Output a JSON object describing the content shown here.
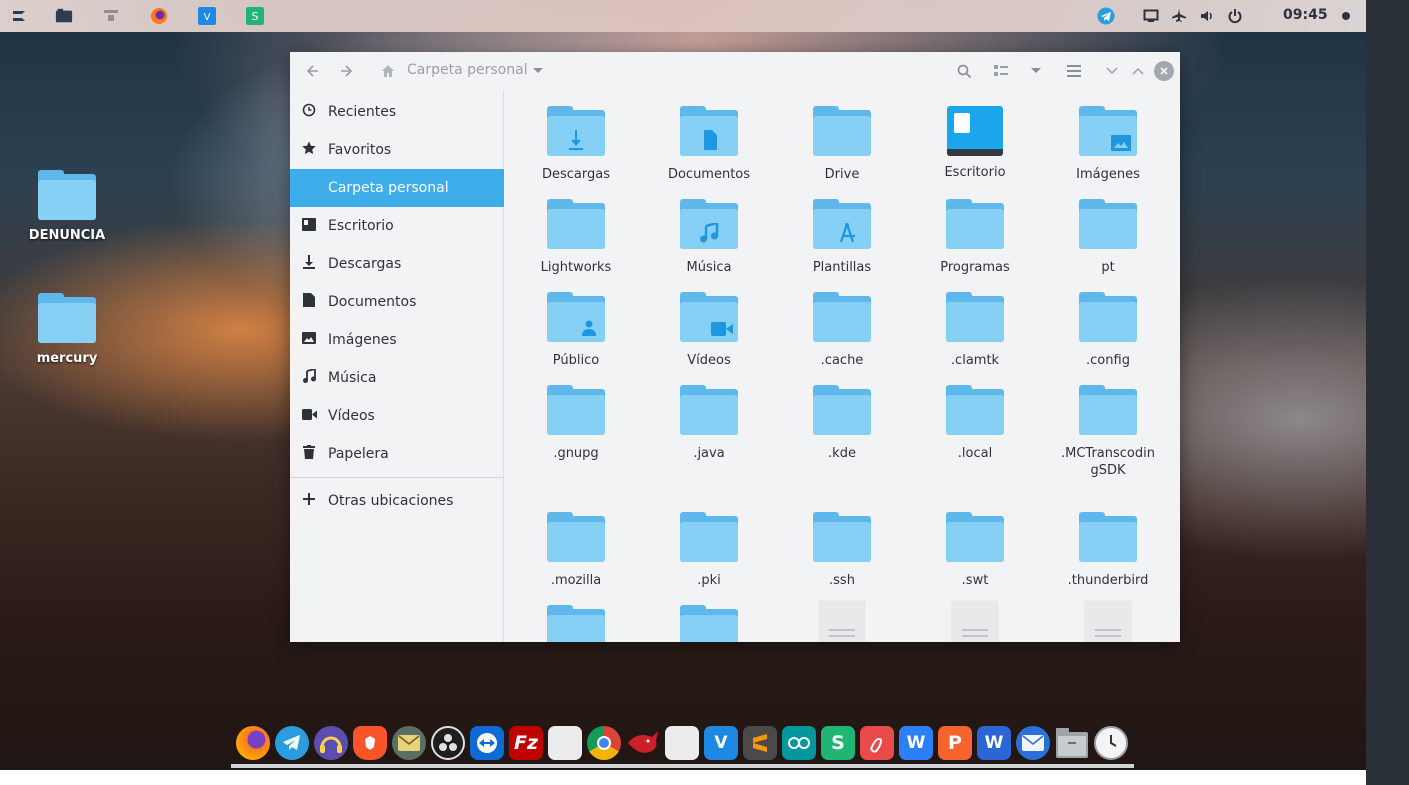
{
  "top_panel": {
    "clock": "09:45",
    "left_icons": [
      "zorin-menu-icon",
      "workspace-icon",
      "network-icon",
      "firefox-icon",
      "vscode-icon",
      "sheets-icon"
    ],
    "tray_icons": [
      "telegram-icon",
      "screen-icon",
      "airplane-icon",
      "volume-icon",
      "power-icon",
      "notification-dot-icon"
    ]
  },
  "desktop": {
    "icons": [
      {
        "label": "DENUNCIA"
      },
      {
        "label": "mercury"
      }
    ]
  },
  "window": {
    "path_label": "Carpeta personal"
  },
  "sidebar": {
    "items": [
      {
        "label": "Recientes",
        "icon": "clock-icon"
      },
      {
        "label": "Favoritos",
        "icon": "star-icon"
      },
      {
        "label": "Carpeta personal",
        "icon": "home-icon"
      },
      {
        "label": "Escritorio",
        "icon": "desktop-icon"
      },
      {
        "label": "Descargas",
        "icon": "download-icon"
      },
      {
        "label": "Documentos",
        "icon": "document-icon"
      },
      {
        "label": "Imágenes",
        "icon": "image-icon"
      },
      {
        "label": "Música",
        "icon": "music-icon"
      },
      {
        "label": "Vídeos",
        "icon": "video-icon"
      },
      {
        "label": "Papelera",
        "icon": "trash-icon"
      }
    ],
    "other_locations": "Otras ubicaciones"
  },
  "files": [
    {
      "label": "Descargas"
    },
    {
      "label": "Documentos"
    },
    {
      "label": "Drive"
    },
    {
      "label": "Escritorio"
    },
    {
      "label": "Imágenes"
    },
    {
      "label": "Lightworks"
    },
    {
      "label": "Música"
    },
    {
      "label": "Plantillas"
    },
    {
      "label": "Programas"
    },
    {
      "label": "pt"
    },
    {
      "label": "Público"
    },
    {
      "label": "Vídeos"
    },
    {
      "label": ".cache"
    },
    {
      "label": ".clamtk"
    },
    {
      "label": ".config"
    },
    {
      "label": ".gnupg"
    },
    {
      "label": ".java"
    },
    {
      "label": ".kde"
    },
    {
      "label": ".local"
    },
    {
      "label": ".MCTranscodingSDK"
    },
    {
      "label": ".mozilla"
    },
    {
      "label": ".pki"
    },
    {
      "label": ".ssh"
    },
    {
      "label": ".swt"
    },
    {
      "label": ".thunderbird"
    }
  ],
  "dock": {
    "apps": [
      "firefox-icon",
      "telegram-icon",
      "audio-app-icon",
      "brave-icon",
      "mail-app-icon",
      "obs-icon",
      "teamviewer-icon",
      "filezilla-icon",
      "blank-app-icon",
      "chrome-icon",
      "shark-app-icon",
      "blank-app-icon-2",
      "vscode-icon",
      "sublime-icon",
      "arduino-icon",
      "sheets-icon",
      "pdf-icon",
      "writer-icon",
      "presentation-icon",
      "word-icon",
      "thunderbird-icon",
      "files-icon",
      "clock-icon"
    ]
  }
}
